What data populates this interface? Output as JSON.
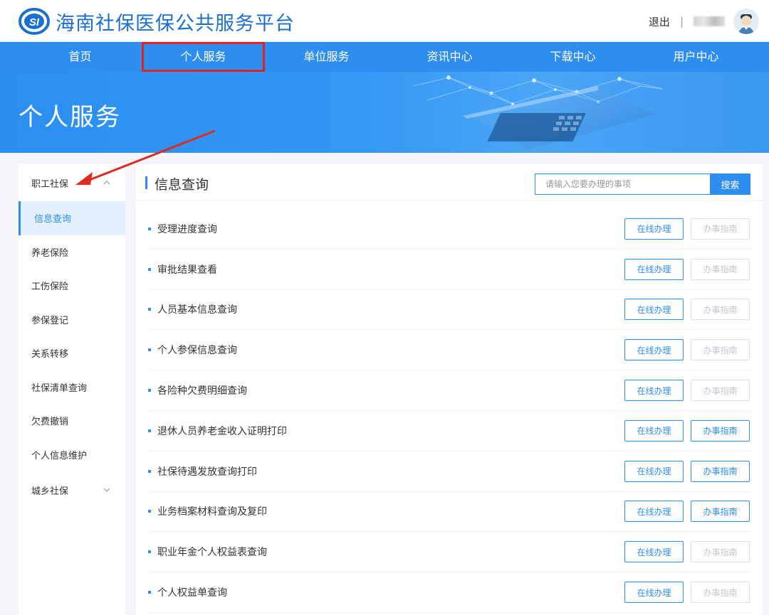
{
  "header": {
    "title": "海南社保医保公共服务平台",
    "logout_label": "退出",
    "separator": "|"
  },
  "nav": {
    "items": [
      {
        "label": "首页"
      },
      {
        "label": "个人服务"
      },
      {
        "label": "单位服务"
      },
      {
        "label": "资讯中心"
      },
      {
        "label": "下载中心"
      },
      {
        "label": "用户中心"
      }
    ],
    "highlighted": "个人服务"
  },
  "banner": {
    "title": "个人服务"
  },
  "sidebar": {
    "group_expanded": "职工社保",
    "items": [
      {
        "label": "信息查询",
        "active": true
      },
      {
        "label": "养老保险"
      },
      {
        "label": "工伤保险"
      },
      {
        "label": "参保登记"
      },
      {
        "label": "关系转移"
      },
      {
        "label": "社保清单查询"
      },
      {
        "label": "欠费撤销"
      },
      {
        "label": "个人信息维护"
      }
    ],
    "group_collapsed": "城乡社保"
  },
  "main": {
    "section_title": "信息查询",
    "search": {
      "placeholder": "请输入您要办理的事项",
      "button_label": "搜索"
    },
    "online_label": "在线办理",
    "guide_label": "办事指南",
    "rows": [
      {
        "label": "受理进度查询",
        "guide_enabled": false
      },
      {
        "label": "审批结果查看",
        "guide_enabled": false
      },
      {
        "label": "人员基本信息查询",
        "guide_enabled": false
      },
      {
        "label": "个人参保信息查询",
        "guide_enabled": false
      },
      {
        "label": "各险种欠费明细查询",
        "guide_enabled": false
      },
      {
        "label": "退休人员养老金收入证明打印",
        "guide_enabled": true
      },
      {
        "label": "社保待遇发放查询打印",
        "guide_enabled": true
      },
      {
        "label": "业务档案材料查询及复印",
        "guide_enabled": true
      },
      {
        "label": "职业年金个人权益表查询",
        "guide_enabled": false
      },
      {
        "label": "个人权益单查询",
        "guide_enabled": false
      }
    ]
  },
  "colors": {
    "primary": "#2e8ef0",
    "brand_title": "#1b6fd0",
    "highlight_box": "#e52020",
    "annotation_arrow": "#e02a22"
  }
}
